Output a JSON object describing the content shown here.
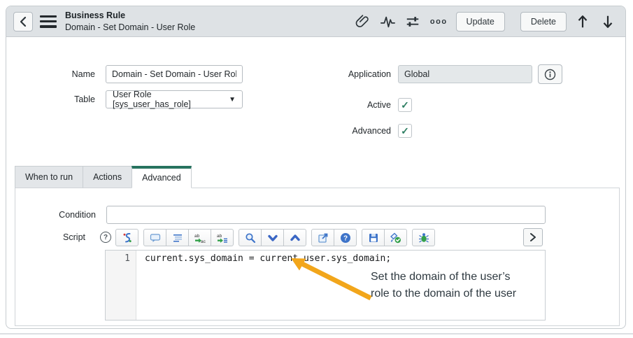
{
  "header": {
    "title": "Business Rule",
    "subtitle": "Domain - Set Domain - User Role",
    "more_glyph": "ooo",
    "update_label": "Update",
    "delete_label": "Delete"
  },
  "form": {
    "name": {
      "label": "Name",
      "value": "Domain - Set Domain - User Role"
    },
    "table": {
      "label": "Table",
      "value": "User Role [sys_user_has_role]",
      "dropdown_glyph": "▼"
    },
    "application": {
      "label": "Application",
      "value": "Global"
    },
    "active": {
      "label": "Active",
      "checked": true,
      "check_glyph": "✓"
    },
    "advanced": {
      "label": "Advanced",
      "checked": true,
      "check_glyph": "✓"
    }
  },
  "tabs": [
    {
      "label": "When to run",
      "active": false
    },
    {
      "label": "Actions",
      "active": false
    },
    {
      "label": "Advanced",
      "active": true
    }
  ],
  "advanced_section": {
    "condition": {
      "label": "Condition",
      "value": ""
    },
    "script": {
      "label": "Script",
      "help_glyph": "?",
      "toolbar_icons": [
        "script-format",
        "comment",
        "format-code",
        "replace",
        "replace-all",
        "search",
        "expand-all",
        "collapse-all",
        "open-in-window",
        "editor-help",
        "save",
        "syntax-check",
        "debug"
      ],
      "line_number": "1",
      "code": "current.sys_domain = current.user.sys_domain;"
    }
  },
  "annotation": {
    "text_line1": "Set the domain of the user’s",
    "text_line2": "role to the domain of the user",
    "arrow_color": "#F2A61B"
  },
  "colors": {
    "accent_teal": "#27735F",
    "check_green": "#2E7F63",
    "header_bg": "#DEE2E5",
    "readonly_bg": "#E4E8EA",
    "toolbar_icon_blue": "#3E74C9",
    "annotation_orange": "#F2A61B"
  }
}
